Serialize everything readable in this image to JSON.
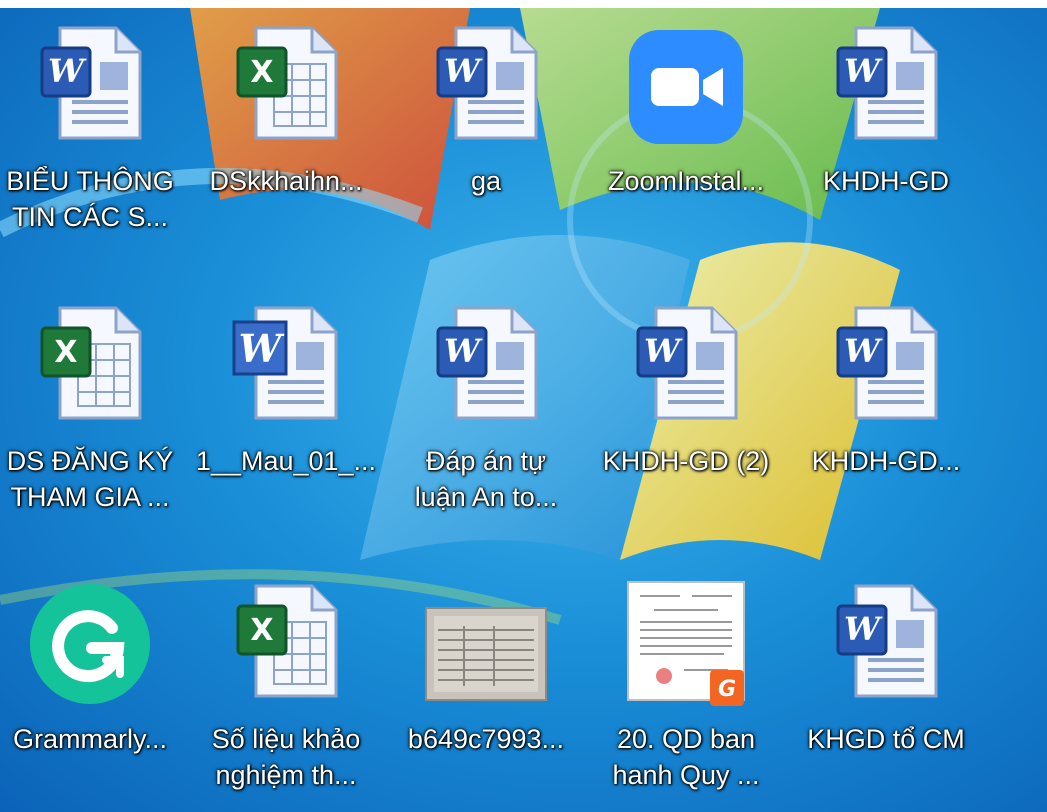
{
  "desktop": {
    "icons": [
      {
        "icon": "word-doc-icon",
        "line1": "BIỂU THÔNG",
        "line2": "TIN CÁC S..."
      },
      {
        "icon": "excel-doc-icon",
        "line1": "DSkkhaihn...",
        "line2": ""
      },
      {
        "icon": "word-doc-icon",
        "line1": "ga",
        "line2": ""
      },
      {
        "icon": "zoom-app-icon",
        "line1": "ZoomInstal...",
        "line2": ""
      },
      {
        "icon": "word-doc-icon",
        "line1": "KHDH-GD",
        "line2": ""
      },
      {
        "icon": "excel-doc-icon",
        "line1": "DS ĐĂNG KÝ",
        "line2": "THAM GIA ..."
      },
      {
        "icon": "word-legacy-icon",
        "line1": "1__Mau_01_...",
        "line2": ""
      },
      {
        "icon": "word-doc-icon",
        "line1": "Đáp án tự",
        "line2": "luận An to..."
      },
      {
        "icon": "word-doc-icon",
        "line1": "KHDH-GD (2)",
        "line2": ""
      },
      {
        "icon": "word-doc-icon",
        "line1": "KHDH-GD...",
        "line2": ""
      },
      {
        "icon": "grammarly-icon",
        "line1": "Grammarly...",
        "line2": ""
      },
      {
        "icon": "excel-doc-icon",
        "line1": "Số liệu khảo",
        "line2": "nghiệm th..."
      },
      {
        "icon": "image-thumbnail-icon",
        "line1": "b649c7993...",
        "line2": ""
      },
      {
        "icon": "pdf-thumbnail-icon",
        "line1": "20. QD ban",
        "line2": "hanh Quy ..."
      },
      {
        "icon": "word-doc-icon",
        "line1": "KHGD tổ CM",
        "line2": ""
      }
    ]
  },
  "colors": {
    "word": "#2b5bb5",
    "excel": "#1f7a3a",
    "zoom": "#2d8cff",
    "grammarly": "#15c39a",
    "foxit": "#f26522"
  }
}
